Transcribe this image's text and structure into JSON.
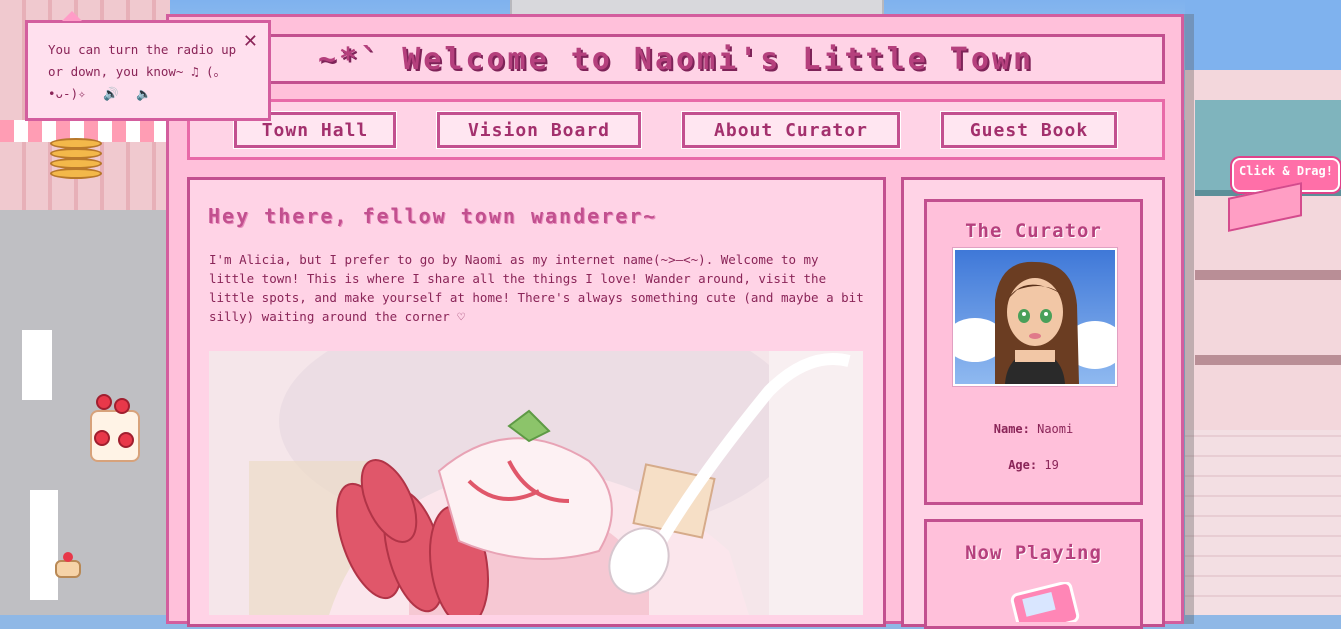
{
  "site": {
    "title": "~*` Welcome to Naomi's Little Town"
  },
  "nav": {
    "items": [
      {
        "label": "Town Hall"
      },
      {
        "label": "Vision Board"
      },
      {
        "label": "About Curator"
      },
      {
        "label": "Guest Book"
      }
    ]
  },
  "main": {
    "heading": "Hey there, fellow town wanderer~",
    "intro": "I'm Alicia, but I prefer to go by Naomi as my internet name(~>—<~). Welcome to my little town! This is where I share all the things I love! Wander around, visit the little spots, and make yourself at home! There's always something cute (and maybe a bit silly) waiting around the corner ♡"
  },
  "sidebar": {
    "curator_heading": "The Curator",
    "name_label": "Name:",
    "name_value": "Naomi",
    "age_label": "Age:",
    "age_value": "19",
    "now_playing_heading": "Now Playing"
  },
  "radio_tip": {
    "text": "You can turn the radio up or down, you know~ ♫ (｡•ᴗ-)✧",
    "close_symbol": "✕",
    "vol_up_icon": "volume-up-icon",
    "vol_down_icon": "volume-down-icon"
  },
  "drag_widget": {
    "label": "Click & Drag!"
  },
  "colors": {
    "frame_pink": "#ffc0da",
    "border_magenta": "#c2508f",
    "text_plum": "#8a2558"
  }
}
